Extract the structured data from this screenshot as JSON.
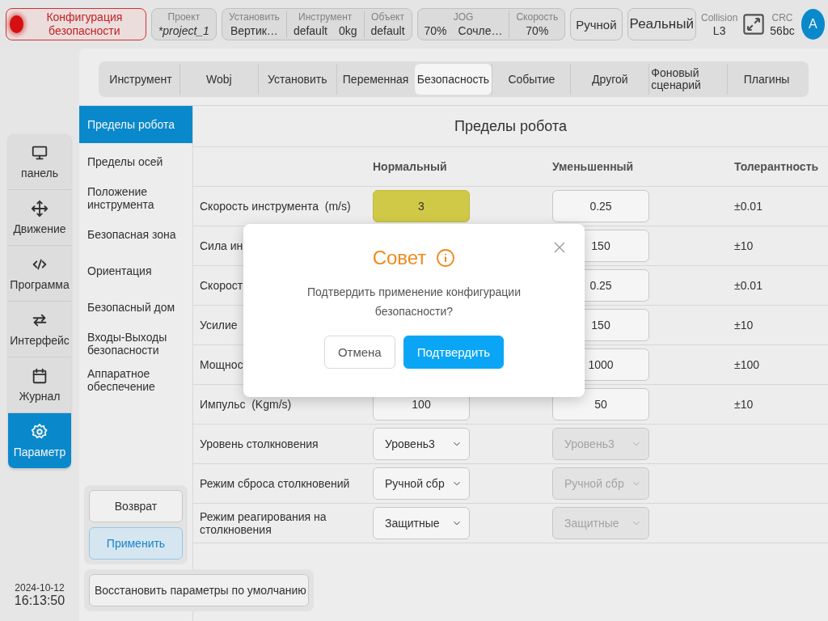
{
  "top_bar": {
    "safety_config": {
      "label": "Конфигурация безопасности",
      "alarm": true
    },
    "groups": [
      {
        "fields": [
          {
            "label": "Проект",
            "values": [
              "*project_1"
            ]
          }
        ]
      },
      {
        "fields": [
          {
            "label": "Установить",
            "values": [
              "Вертик…"
            ]
          },
          {
            "label": "Инструмент",
            "values": [
              "default",
              "0kg"
            ]
          },
          {
            "label": "Объект",
            "values": [
              "default"
            ]
          }
        ]
      },
      {
        "fields": [
          {
            "label": "JOG",
            "values": [
              "70%",
              "Сочле…"
            ]
          },
          {
            "label": "Скорость",
            "values": [
              "70%"
            ]
          }
        ]
      }
    ],
    "mode_buttons": [
      "Ручной",
      "Реальный"
    ],
    "collision": {
      "label": "Collision",
      "value": "L3"
    },
    "crc": {
      "label": "CRC",
      "value": "56bc"
    },
    "avatar": "A"
  },
  "nav": [
    {
      "label": "панель",
      "selected": false
    },
    {
      "label": "Движение",
      "selected": false
    },
    {
      "label": "Программа",
      "selected": false
    },
    {
      "label": "Интерфейс",
      "selected": false
    },
    {
      "label": "Журнал",
      "selected": false
    },
    {
      "label": "Параметр",
      "selected": true
    }
  ],
  "clock": {
    "date": "2024-10-12",
    "time": "16:13:50"
  },
  "tabs": [
    {
      "label": "Инструмент",
      "selected": false
    },
    {
      "label": "Wobj",
      "selected": false
    },
    {
      "label": "Установить",
      "selected": false
    },
    {
      "label": "Переменная",
      "selected": false
    },
    {
      "label": "Безопасность",
      "selected": true
    },
    {
      "label": "Событие",
      "selected": false
    },
    {
      "label": "Другой",
      "selected": false
    },
    {
      "label": "Фоновый сценарий",
      "selected": false
    },
    {
      "label": "Плагины",
      "selected": false
    }
  ],
  "side_menu": [
    {
      "label": "Пределы робота",
      "selected": true
    },
    {
      "label": "Пределы осей",
      "selected": false
    },
    {
      "label": "Положение инструмента",
      "selected": false
    },
    {
      "label": "Безопасная зона",
      "selected": false
    },
    {
      "label": "Ориентация",
      "selected": false
    },
    {
      "label": "Безопасный дом",
      "selected": false
    },
    {
      "label": "Входы-Выходы безопасности",
      "selected": false
    },
    {
      "label": "Аппаратное обеспечение",
      "selected": false
    }
  ],
  "side_buttons": [
    {
      "label": "Возврат",
      "kind": "plain"
    },
    {
      "label": "Применить",
      "kind": "primary"
    }
  ],
  "restore_button": "Восстановить параметры по умолчанию",
  "panel_title": "Пределы робота",
  "columns": [
    "Нормальный",
    "Уменьшенный",
    "Толерантность"
  ],
  "rows": [
    {
      "label": "Скорость инструмента  (m/s)",
      "normal": {
        "kind": "input",
        "value": "3",
        "highlighted": true
      },
      "reduced": {
        "kind": "input",
        "value": "0.25"
      },
      "tolerance": "±0.01"
    },
    {
      "label": "Сила ин",
      "reduced": {
        "kind": "input",
        "value": "150"
      },
      "tolerance": "±10"
    },
    {
      "label": "Скорост",
      "reduced": {
        "kind": "input",
        "value": "0.25"
      },
      "tolerance": "±0.01"
    },
    {
      "label": "Усилие",
      "reduced": {
        "kind": "input",
        "value": "150"
      },
      "tolerance": "±10"
    },
    {
      "label": "Мощнос",
      "reduced": {
        "kind": "input",
        "value": "1000"
      },
      "tolerance": "±100"
    },
    {
      "label": "Импульс  (Kgm/s)",
      "normal": {
        "kind": "input",
        "value": "100",
        "highlighted": false
      },
      "reduced": {
        "kind": "input",
        "value": "50"
      },
      "tolerance": "±10"
    },
    {
      "label": "Уровень столкновения",
      "normal": {
        "kind": "select",
        "value": "Уровень3",
        "highlighted": false
      },
      "reduced": {
        "kind": "select",
        "value": "Уровень3",
        "disabled": true
      }
    },
    {
      "label": "Режим сброса столкновений",
      "normal": {
        "kind": "select",
        "value": "Ручной сбр",
        "highlighted": false
      },
      "reduced": {
        "kind": "select",
        "value": "Ручной сбр",
        "disabled": true
      }
    },
    {
      "label": "Режим реагирования на столкновения",
      "normal": {
        "kind": "select",
        "value": "Защитные",
        "highlighted": false
      },
      "reduced": {
        "kind": "select",
        "value": "Защитные",
        "disabled": true
      }
    }
  ],
  "dialog": {
    "title": "Совет",
    "message": "Подтвердить применение конфигурации безопасности?",
    "buttons": [
      {
        "label": "Отмена",
        "kind": "cancel"
      },
      {
        "label": "Подтвердить",
        "kind": "confirm"
      }
    ]
  }
}
